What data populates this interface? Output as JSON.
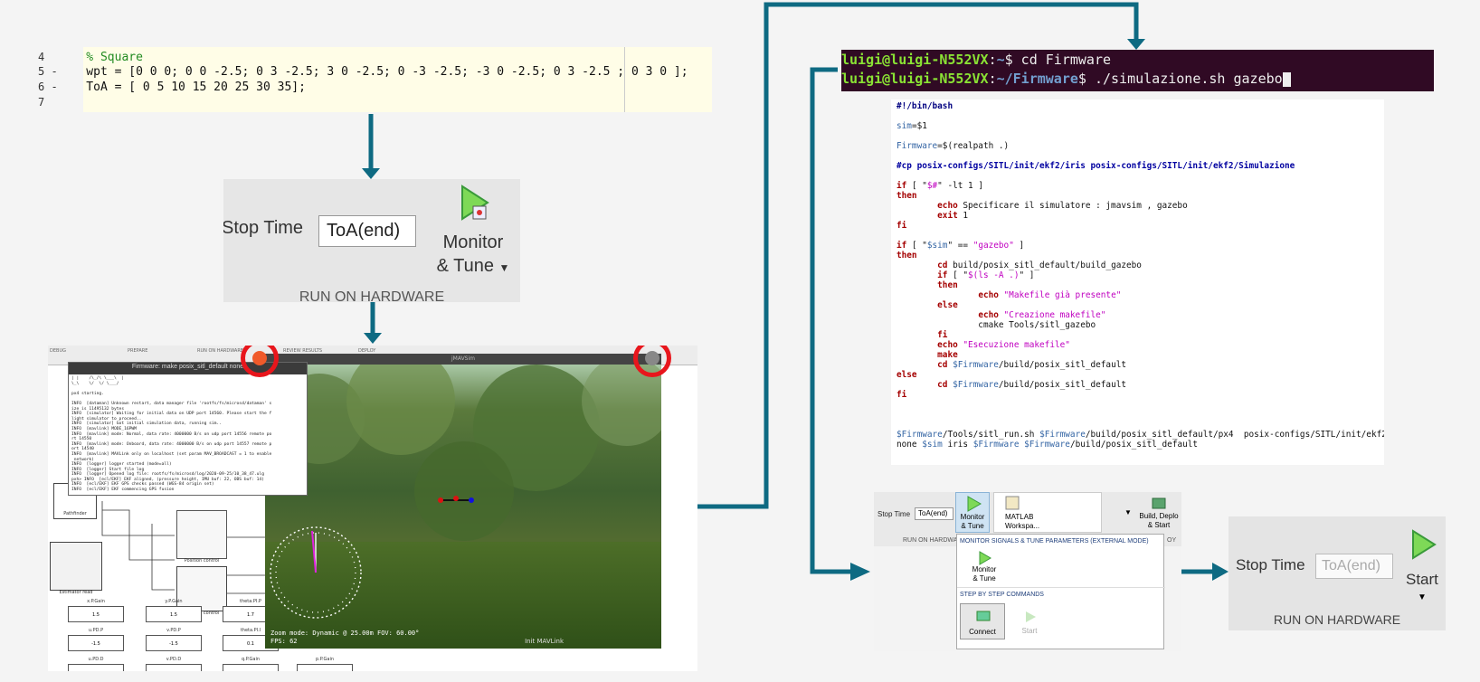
{
  "editor": {
    "lines": [
      {
        "num": "4",
        "code": "    % Square",
        "comment": true
      },
      {
        "num": "5 -",
        "code": "    wpt = [0 0 0; 0 0 -2.5; 0 3 -2.5; 3 0 -2.5; 0 -3 -2.5; -3 0 -2.5; 0 3 -2.5 ; 0 3 0 ];",
        "comment": false
      },
      {
        "num": "6 -",
        "code": "    ToA = [ 0 5 10 15 20 25 30 35];",
        "comment": false
      },
      {
        "num": "7",
        "code": "",
        "comment": false
      }
    ]
  },
  "panel_a": {
    "stop_time_label": "Stop Time",
    "stop_time_value": "ToA(end)",
    "monitor_line1": "Monitor",
    "monitor_line2": "& Tune",
    "footer": "RUN ON HARDWARE"
  },
  "sim": {
    "ribbon": [
      "DEBUG",
      "PREPARE",
      "RUN ON HARDWARE",
      "REVIEW RESULTS",
      "DEPLOY"
    ],
    "terminal_title": "Firmware: make posix_sitl_default none",
    "terminal_text": "| |    /\\_/\\ \\___\\  |\n\\_\\    \\/  \\/ \\___/\n\npx4 starting.\n\nINFO  [dataman] Unknown restart, data manager file 'rootfs/fs/microsd/dataman' s\nize is 11495132 bytes\nINFO  [simulator] Waiting for initial data on UDP port 14560. Please start the f\nlight simulator to proceed..\nINFO  [simulator] Got initial simulation data, running sim..\nINFO  [mavlink] MODE_16PWM\nINFO  [mavlink] mode: Normal, data rate: 4000000 B/s on udp port 14556 remote po\nrt 14550\nINFO  [mavlink] mode: Onboard, data rate: 4000000 B/s on udp port 14557 remote p\nort 14540\nINFO  [mavlink] MAVLink only on localhost (set param MAV_BROADCAST = 1 to enable\n network)\nINFO  [logger] logger started (mode=all)\nINFO  [logger] Start file log\nINFO  [logger] Opened log file: rootfs/fs/microsd/log/2020-09-25/10_38_47.ulg\npxh> INFO  [ecl/EKF] EKF aligned, (pressure height, IMU buf: 22, OBS buf: 14)\nINFO  [ecl/EKF] EKF GPS checks passed (WGS-84 origin set)\nINFO  [ecl/EKF] EKF commencing GPS fusion",
    "jmavsim_title": "jMAVSim",
    "status_line1": "Zoom mode: Dynamic @ 25.00m    FOV: 60.00°",
    "status_line2": "FPS: 62",
    "mavlink_label": "Init MAVLink",
    "blocks": {
      "pathfinder": "Pathfinder",
      "position": "Position control",
      "estimator": "Estimator read",
      "altitude": "Altitude control",
      "attitude": "Attitude control"
    },
    "gains": [
      {
        "label": "x.P.Gain",
        "value": "1.5"
      },
      {
        "label": "y.P.Gain",
        "value": "1.5"
      },
      {
        "label": "theta.PI.P",
        "value": "1.7"
      },
      {
        "label": "u.PD.P",
        "value": "-1.5"
      },
      {
        "label": "v.PD.P",
        "value": "-1.5"
      },
      {
        "label": "theta.PI.I",
        "value": "0.1"
      },
      {
        "label": "u.PD.D",
        "value": ""
      },
      {
        "label": "v.PD.D",
        "value": ""
      },
      {
        "label": "q.P.Gain",
        "value": ""
      },
      {
        "label": "p.P.Gain",
        "value": ""
      }
    ]
  },
  "uterm": {
    "line1_user": "luigi@luigi-N552VX",
    "line1_path": "~",
    "line1_cmd": "$ cd Firmware",
    "line2_user": "luigi@luigi-N552VX",
    "line2_path": "~/Firmware",
    "line2_cmd": "$ ./simulazione.sh gazebo"
  },
  "script": {
    "lines": [
      [
        {
          "c": "hd",
          "t": "#!/bin/bash"
        }
      ],
      [],
      [
        {
          "c": "vr",
          "t": "sim"
        },
        {
          "c": "",
          "t": "=$1"
        }
      ],
      [],
      [
        {
          "c": "vr",
          "t": "Firmware"
        },
        {
          "c": "",
          "t": "=$(realpath .)"
        }
      ],
      [],
      [
        {
          "c": "cm",
          "t": "#cp posix-configs/SITL/init/ekf2/iris posix-configs/SITL/init/ekf2/Simulazione"
        }
      ],
      [],
      [
        {
          "c": "kw",
          "t": "if"
        },
        {
          "c": "",
          "t": " [ \""
        },
        {
          "c": "st",
          "t": "$#"
        },
        {
          "c": "",
          "t": "\" -lt 1 ]"
        }
      ],
      [
        {
          "c": "kw",
          "t": "then"
        }
      ],
      [
        {
          "c": "",
          "t": "        "
        },
        {
          "c": "kw",
          "t": "echo"
        },
        {
          "c": "",
          "t": " Specificare il simulatore : jmavsim , gazebo"
        }
      ],
      [
        {
          "c": "",
          "t": "        "
        },
        {
          "c": "kw",
          "t": "exit"
        },
        {
          "c": "",
          "t": " 1"
        }
      ],
      [
        {
          "c": "kw",
          "t": "fi"
        }
      ],
      [],
      [
        {
          "c": "kw",
          "t": "if"
        },
        {
          "c": "",
          "t": " [ \""
        },
        {
          "c": "vr",
          "t": "$sim"
        },
        {
          "c": "",
          "t": "\" == "
        },
        {
          "c": "st",
          "t": "\"gazebo\""
        },
        {
          "c": "",
          "t": " ]"
        }
      ],
      [
        {
          "c": "kw",
          "t": "then"
        }
      ],
      [
        {
          "c": "",
          "t": "        "
        },
        {
          "c": "kw",
          "t": "cd"
        },
        {
          "c": "",
          "t": " build/posix_sitl_default/build_gazebo"
        }
      ],
      [
        {
          "c": "",
          "t": "        "
        },
        {
          "c": "kw",
          "t": "if"
        },
        {
          "c": "",
          "t": " [ \""
        },
        {
          "c": "st",
          "t": "$(ls -A .)"
        },
        {
          "c": "",
          "t": "\" ]"
        }
      ],
      [
        {
          "c": "",
          "t": "        "
        },
        {
          "c": "kw",
          "t": "then"
        }
      ],
      [
        {
          "c": "",
          "t": "                "
        },
        {
          "c": "kw",
          "t": "echo"
        },
        {
          "c": "st",
          "t": " \"Makefile già presente\""
        }
      ],
      [
        {
          "c": "",
          "t": "        "
        },
        {
          "c": "kw",
          "t": "else"
        }
      ],
      [
        {
          "c": "",
          "t": "                "
        },
        {
          "c": "kw",
          "t": "echo"
        },
        {
          "c": "st",
          "t": " \"Creazione makefile\""
        }
      ],
      [
        {
          "c": "",
          "t": "                cmake Tools/sitl_gazebo"
        }
      ],
      [
        {
          "c": "",
          "t": "        "
        },
        {
          "c": "kw",
          "t": "fi"
        }
      ],
      [
        {
          "c": "",
          "t": "        "
        },
        {
          "c": "kw",
          "t": "echo"
        },
        {
          "c": "st",
          "t": " \"Esecuzione makefile\""
        }
      ],
      [
        {
          "c": "",
          "t": "        "
        },
        {
          "c": "kw",
          "t": "make"
        }
      ],
      [
        {
          "c": "",
          "t": "        "
        },
        {
          "c": "kw",
          "t": "cd"
        },
        {
          "c": "vr",
          "t": " $Firmware"
        },
        {
          "c": "",
          "t": "/build/posix_sitl_default"
        }
      ],
      [
        {
          "c": "kw",
          "t": "else"
        }
      ],
      [
        {
          "c": "",
          "t": "        "
        },
        {
          "c": "kw",
          "t": "cd"
        },
        {
          "c": "vr",
          "t": " $Firmware"
        },
        {
          "c": "",
          "t": "/build/posix_sitl_default"
        }
      ],
      [
        {
          "c": "kw",
          "t": "fi"
        }
      ],
      [],
      [],
      [],
      [
        {
          "c": "vr",
          "t": "$Firmware"
        },
        {
          "c": "",
          "t": "/Tools/sitl_run.sh "
        },
        {
          "c": "vr",
          "t": "$Firmware"
        },
        {
          "c": "",
          "t": "/build/posix_sitl_default/px4  posix-configs/SITL/init/ekf2"
        }
      ],
      [
        {
          "c": "",
          "t": "none "
        },
        {
          "c": "vr",
          "t": "$sim"
        },
        {
          "c": "",
          "t": " iris "
        },
        {
          "c": "vr",
          "t": "$Firmware $Firmware"
        },
        {
          "c": "",
          "t": "/build/posix_sitl_default"
        }
      ]
    ]
  },
  "mlab": {
    "stop_time_label": "Stop Time",
    "stop_time_value": "ToA(end)",
    "monitor_line1": "Monitor",
    "monitor_line2": "& Tune",
    "matlab_line1": "MATLAB",
    "matlab_line2": "Workspa...",
    "build_line1": "Build, Deplo",
    "build_line2": "& Start",
    "ribbon_footer": "RUN ON HARDWA",
    "ribbon_footer2": "OY",
    "menu_header1": "MONITOR SIGNALS & TUNE PARAMETERS (EXTERNAL MODE)",
    "menu_monitor1": "Monitor",
    "menu_monitor2": "& Tune",
    "menu_header2": "STEP BY STEP COMMANDS",
    "connect_label": "Connect",
    "start_label": "Start"
  },
  "panel_b": {
    "stop_time_label": "Stop Time",
    "stop_time_value": "ToA(end)",
    "start_label": "Start",
    "footer": "RUN ON HARDWARE"
  },
  "colors": {
    "arrow": "#0e6a82",
    "highlight_ring": "#e8161c",
    "run_icon": "#3fbf3f"
  }
}
